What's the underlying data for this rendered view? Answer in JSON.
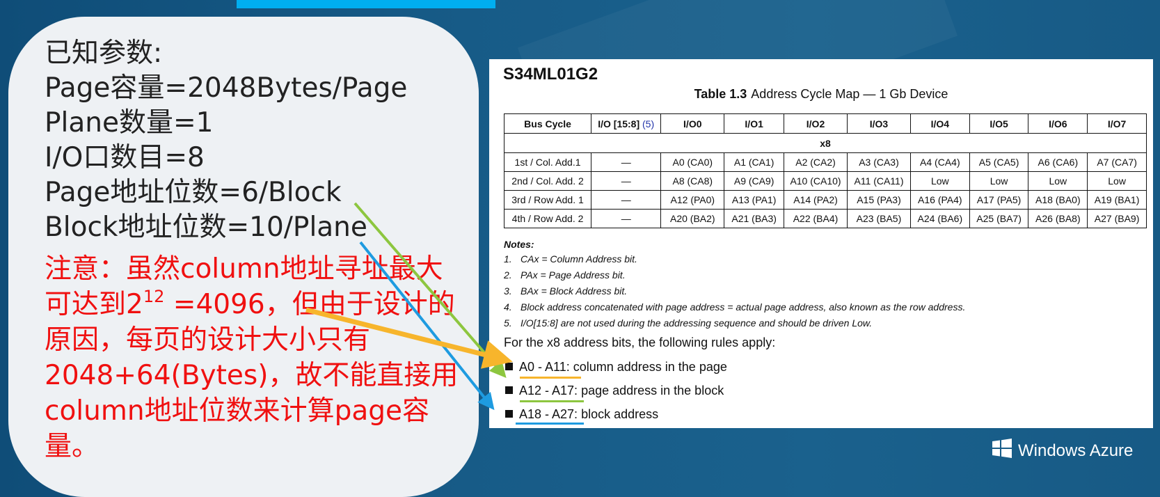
{
  "known": {
    "heading": "已知参数:",
    "lines": [
      "Page容量=2048Bytes/Page",
      "Plane数量=1",
      "I/O口数目=8",
      "Page地址位数=6/Block",
      "Block地址位数=10/Plane"
    ]
  },
  "note": {
    "p1": "注意：虽然column地址寻址最大可达到2",
    "sup": "12",
    "p2": " =4096，但由于设计的原因，每页的设计大小只有2048+64(Bytes)，故不能直接用column地址位数来计算page容量。"
  },
  "doc": {
    "part_number": "S34ML01G2",
    "table_label": "Table 1.3",
    "table_title": "Address Cycle Map — 1 Gb Device",
    "headers": [
      "Bus Cycle",
      "I/O [15:8]",
      "I/O0",
      "I/O1",
      "I/O2",
      "I/O3",
      "I/O4",
      "I/O5",
      "I/O6",
      "I/O7"
    ],
    "header_ref": "(5)",
    "span_row": "x8",
    "rows": [
      [
        "1st / Col. Add.1",
        "—",
        "A0 (CA0)",
        "A1 (CA1)",
        "A2 (CA2)",
        "A3 (CA3)",
        "A4 (CA4)",
        "A5 (CA5)",
        "A6 (CA6)",
        "A7 (CA7)"
      ],
      [
        "2nd / Col. Add. 2",
        "—",
        "A8 (CA8)",
        "A9 (CA9)",
        "A10 (CA10)",
        "A11 (CA11)",
        "Low",
        "Low",
        "Low",
        "Low"
      ],
      [
        "3rd / Row Add. 1",
        "—",
        "A12 (PA0)",
        "A13 (PA1)",
        "A14 (PA2)",
        "A15 (PA3)",
        "A16 (PA4)",
        "A17 (PA5)",
        "A18 (BA0)",
        "A19 (BA1)"
      ],
      [
        "4th / Row Add. 2",
        "—",
        "A20 (BA2)",
        "A21 (BA3)",
        "A22 (BA4)",
        "A23 (BA5)",
        "A24 (BA6)",
        "A25 (BA7)",
        "A26 (BA8)",
        "A27 (BA9)"
      ]
    ],
    "notes_heading": "Notes:",
    "notes": [
      {
        "num": "1.",
        "text": "CAx = Column Address bit."
      },
      {
        "num": "2.",
        "text": "PAx = Page Address bit."
      },
      {
        "num": "3.",
        "text": "BAx = Block Address bit."
      },
      {
        "num": "4.",
        "text": "Block address concatenated with page address = actual page address, also known as the row address."
      },
      {
        "num": "5.",
        "text": "I/O[15:8] are not used during the addressing sequence and should be driven Low."
      }
    ],
    "rules_intro": "For the x8 address bits, the following rules apply:",
    "rules": [
      {
        "range": "A0 - A11:",
        "desc": " column address in the page"
      },
      {
        "range": "A12 - A17:",
        "desc": " page address in the block"
      },
      {
        "range": "A18 - A27:",
        "desc": " block address"
      }
    ]
  },
  "colors": {
    "orange": "#f7b52c",
    "green": "#8dc63f",
    "blue": "#1e9be0",
    "red": "#f01010"
  },
  "icons": [
    "windows-logo-icon"
  ],
  "brand": "Windows Azure"
}
